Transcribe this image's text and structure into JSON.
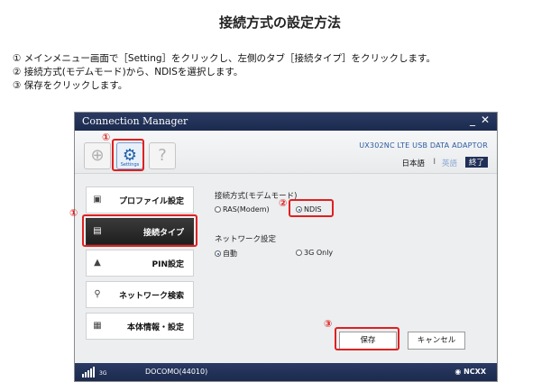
{
  "doc": {
    "title": "接続方式の設定方法",
    "steps": [
      "① メインメニュー画面で［Setting］をクリックし、左側のタブ［接続タイプ］をクリックします。",
      "② 接続方式(モデムモード)から、NDISを選択します。",
      "③ 保存をクリックします。"
    ]
  },
  "window": {
    "title": "Connection Manager",
    "minimize": "_",
    "close": "✕"
  },
  "topbar": {
    "settings_sub": "Settings",
    "model": "UX302NC LTE USB DATA ADAPTOR",
    "lang_ja": "日本語",
    "lang_sep": "I",
    "lang_en": "英語",
    "exit": "終了"
  },
  "sidebar": {
    "items": [
      {
        "label": "プロファイル設定"
      },
      {
        "label": "接続タイプ"
      },
      {
        "label": "PIN設定"
      },
      {
        "label": "ネットワーク検索"
      },
      {
        "label": "本体情報・設定"
      }
    ]
  },
  "connection": {
    "mode_label": "接続方式(モデムモード)",
    "ras": "RAS(Modem)",
    "ndis": "NDIS",
    "selected_mode": "NDIS",
    "network_label": "ネットワーク設定",
    "auto": "自動",
    "g3": "3G Only",
    "selected_network": "自動"
  },
  "buttons": {
    "save": "保存",
    "cancel": "キャンセル"
  },
  "status": {
    "network_type": "3G",
    "carrier": "DOCOMO(44010)",
    "brand": "NCXX"
  },
  "annotations": {
    "one": "①",
    "two": "②",
    "three": "③"
  },
  "colors": {
    "titlebar": "#1f2f57",
    "highlight": "#e02020",
    "active_tab": "#262626",
    "accent": "#1f5ea8"
  }
}
